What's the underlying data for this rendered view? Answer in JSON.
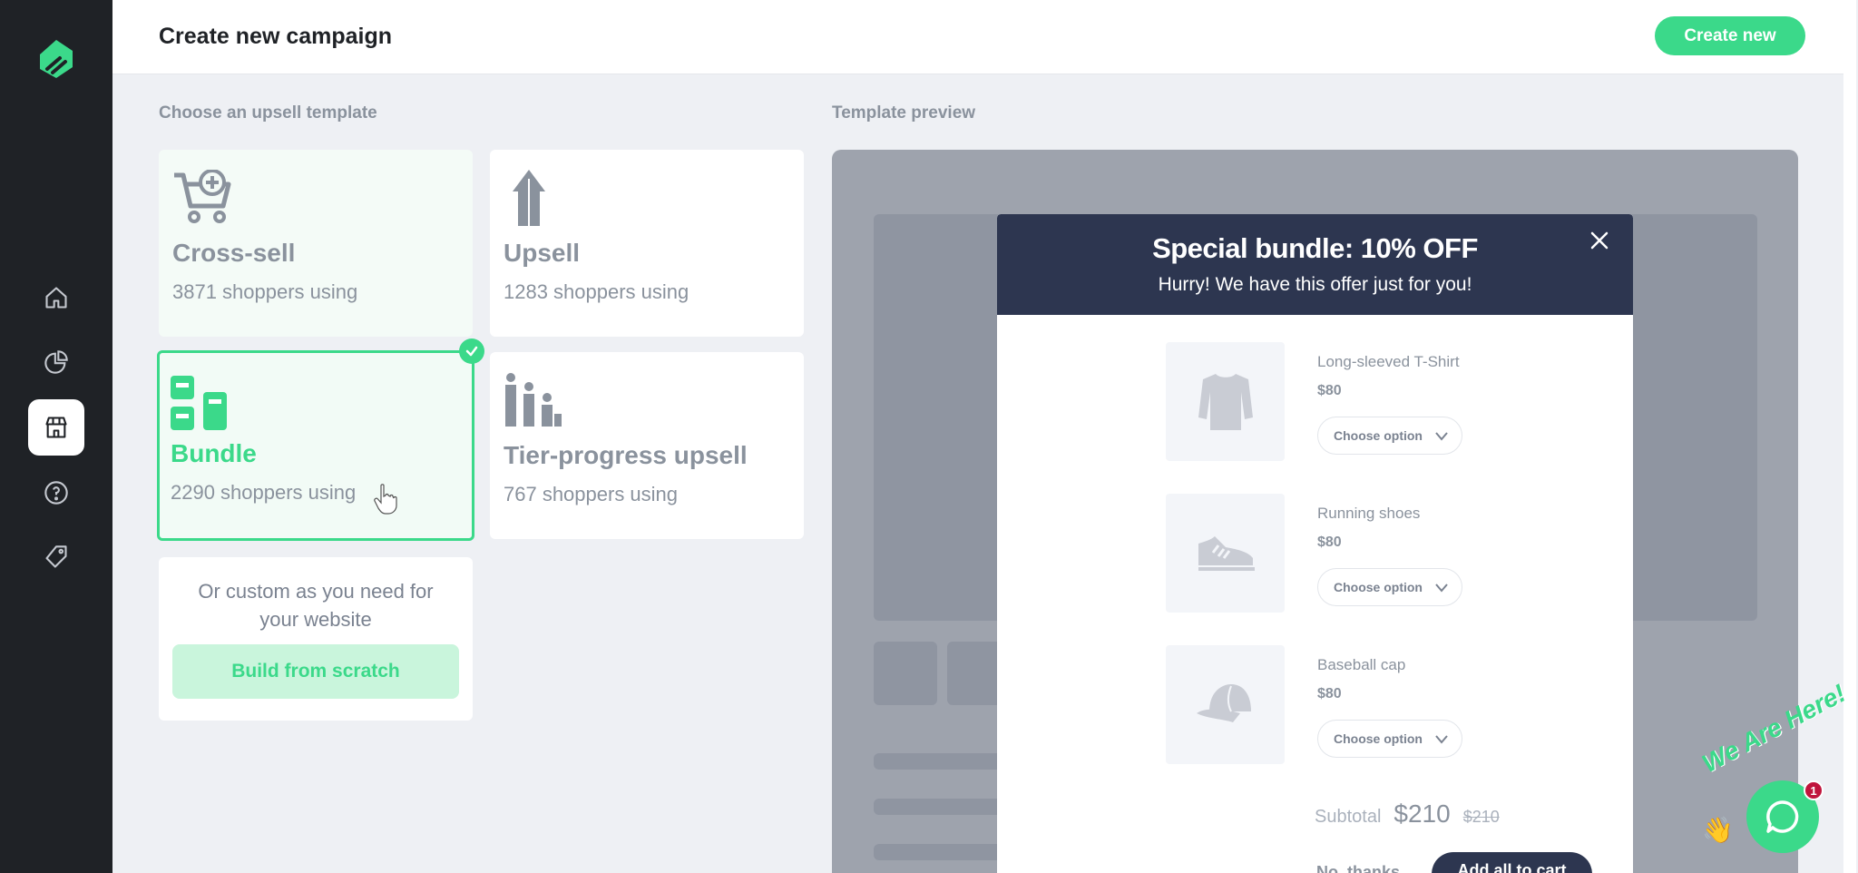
{
  "header": {
    "title": "Create new campaign",
    "create_label": "Create new"
  },
  "sidebar": {
    "items": [
      {
        "icon": "home-icon"
      },
      {
        "icon": "chart-icon"
      },
      {
        "icon": "store-icon",
        "active": true
      },
      {
        "icon": "help-icon"
      },
      {
        "icon": "tag-icon"
      }
    ]
  },
  "templates": {
    "label": "Choose an upsell template",
    "items": [
      {
        "title": "Cross-sell",
        "users": "3871 shoppers using",
        "icon": "cart-plus-icon"
      },
      {
        "title": "Upsell",
        "users": "1283 shoppers using",
        "icon": "arrow-up-icon"
      },
      {
        "title": "Bundle",
        "users": "2290 shoppers using",
        "icon": "bundle-icon",
        "selected": true
      },
      {
        "title": "Tier-progress upsell",
        "users": "767 shoppers using",
        "icon": "tier-icon"
      }
    ],
    "custom_text": "Or custom as you need for your website",
    "scratch_label": "Build from scratch"
  },
  "preview": {
    "label": "Template preview",
    "modal": {
      "title": "Special bundle: 10% OFF",
      "subtitle": "Hurry! We have this offer just for you!",
      "products": [
        {
          "name": "Long-sleeved T-Shirt",
          "price": "$80",
          "option": "Choose option",
          "icon": "shirt-icon"
        },
        {
          "name": "Running shoes",
          "price": "$80",
          "option": "Choose option",
          "icon": "shoe-icon"
        },
        {
          "name": "Baseball cap",
          "price": "$80",
          "option": "Choose option",
          "icon": "cap-icon"
        }
      ],
      "subtotal_label": "Subtotal",
      "subtotal_value": "$210",
      "subtotal_old": "$210",
      "no_thanks": "No, thanks",
      "add_all": "Add all to cart"
    }
  },
  "chat": {
    "tagline": "We Are Here!",
    "badge": "1"
  },
  "colors": {
    "accent": "#3bd98a",
    "dark_navy": "#2d3650",
    "sidebar": "#1f2226"
  }
}
